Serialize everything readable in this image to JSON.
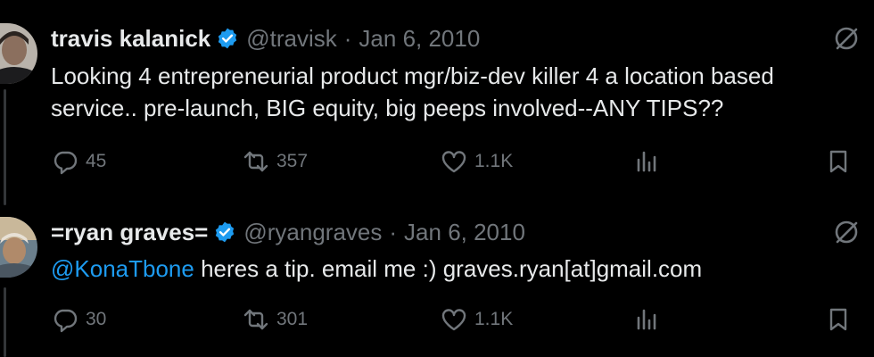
{
  "tweets": [
    {
      "author_name": "travis kalanick",
      "handle": "@travisk",
      "separator": "·",
      "date": "Jan 6, 2010",
      "text_line1": "Looking 4 entrepreneurial product mgr/biz-dev killer 4 a location based",
      "text_line2": "service.. pre-launch, BIG equity, big peeps involved--ANY TIPS??",
      "replies": "45",
      "reposts": "357",
      "likes": "1.1K"
    },
    {
      "author_name": "=ryan graves=",
      "handle": "@ryangraves",
      "separator": "·",
      "date": "Jan 6, 2010",
      "mention": "@KonaTbone",
      "text_rest": " heres a tip. email me :) graves.ryan[at]gmail.com",
      "replies": "30",
      "reposts": "301",
      "likes": "1.1K"
    }
  ],
  "colors": {
    "background": "#000000",
    "text": "#e7e9ea",
    "muted": "#71767b",
    "accent": "#1d9bf0",
    "verified": "#1d9bf0"
  },
  "icons": [
    "verified-badge-icon",
    "grok-icon",
    "reply-icon",
    "repost-icon",
    "like-icon",
    "views-icon",
    "bookmark-icon"
  ]
}
